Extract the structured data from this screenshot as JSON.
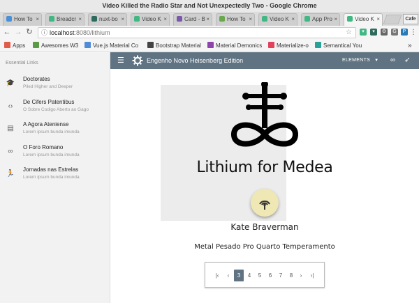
{
  "window": {
    "title": "Video Killed the Radio Star and Not Unexpectedly Two - Google Chrome"
  },
  "tabs": [
    {
      "label": "How To",
      "fav_color": "#4a90d9"
    },
    {
      "label": "Breadcr",
      "fav_color": "#41b883"
    },
    {
      "label": "nuxt-bo",
      "fav_color": "#2e6b5e"
    },
    {
      "label": "Video K",
      "fav_color": "#41b883"
    },
    {
      "label": "Card - B",
      "fav_color": "#7a5aa8"
    },
    {
      "label": "How To",
      "fav_color": "#6aa84f"
    },
    {
      "label": "Video K",
      "fav_color": "#41b883"
    },
    {
      "label": "App Pro",
      "fav_color": "#41b883"
    },
    {
      "label": "Video K",
      "fav_color": "#41b883"
    }
  ],
  "profile_label": "Cafe",
  "address": {
    "host": "localhost",
    "path": ":8080/lithium"
  },
  "bookmarks": [
    {
      "label": "Apps",
      "color": "#e25c4a"
    },
    {
      "label": "Awesomes W3",
      "color": "#5b9b45"
    },
    {
      "label": "Vue.js Material Co",
      "color": "#4f8bd6"
    },
    {
      "label": "Bootstrap Material",
      "color": "#444444"
    },
    {
      "label": "Material Demonics",
      "color": "#8e44ad"
    },
    {
      "label": "Materialize-o",
      "color": "#e0435a"
    },
    {
      "label": "Semantical You",
      "color": "#2aa198"
    }
  ],
  "bookmarks_overflow": "»",
  "appbar": {
    "title": "Engenho Novo Heisenberg Edition",
    "menu_label": "ELEMENTS",
    "color": "#5f7382"
  },
  "sidebar": {
    "heading": "Essential Links",
    "items": [
      {
        "title": "Doctorates",
        "subtitle": "Piled Higher and Deeper",
        "icon": "school-icon",
        "glyph": "🎓"
      },
      {
        "title": "De Cifers Patentibus",
        "subtitle": "O Sobre Codigo Aberto ao Gago",
        "icon": "code-icon",
        "glyph": "‹›"
      },
      {
        "title": "A Agora Ateniense",
        "subtitle": "Lorem ipsum bunda imunda",
        "icon": "chat-icon",
        "glyph": "▤"
      },
      {
        "title": "O Foro Romano",
        "subtitle": "Lorem ipsum bunda imunda",
        "icon": "infinity-icon",
        "glyph": "∞"
      },
      {
        "title": "Jornadas nas Estrelas",
        "subtitle": "Lorem ipsum bunda imunda",
        "icon": "run-icon",
        "glyph": "🏃"
      }
    ]
  },
  "main": {
    "headline": "Lithium for Medea",
    "author": "Kate Braverman",
    "subtitle": "Metal Pesado Pro Quarto Temperamento",
    "fab_color": "#efe7b4"
  },
  "pagination": {
    "first": "|‹",
    "prev": "‹",
    "pages": [
      "3",
      "4",
      "5",
      "6",
      "7",
      "8"
    ],
    "current": "3",
    "next": "›",
    "last": "›|"
  }
}
